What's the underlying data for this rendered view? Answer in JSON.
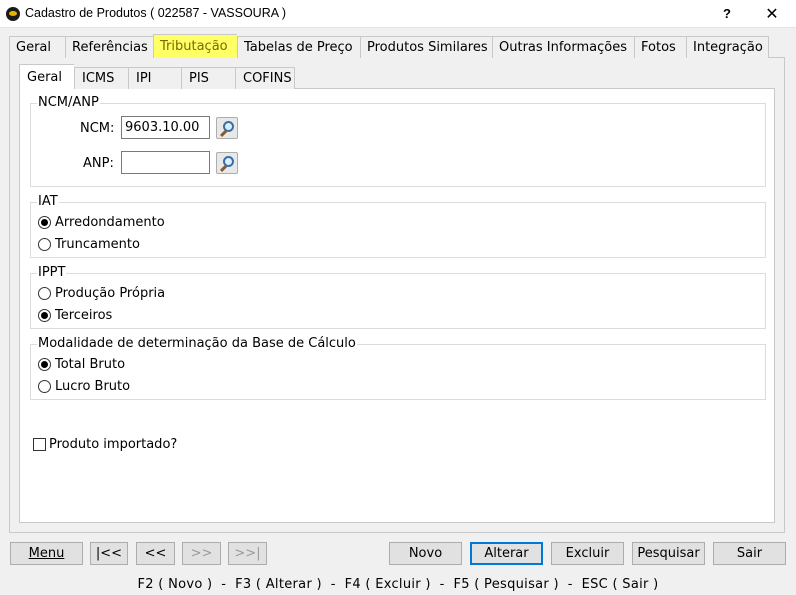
{
  "window": {
    "title": "Cadastro de Produtos ( 022587 - VASSOURA )",
    "help_label": "?",
    "close_label": "✕"
  },
  "outer_tabs": [
    {
      "label": "Geral"
    },
    {
      "label": "Referências"
    },
    {
      "label": "Tributação",
      "active": true
    },
    {
      "label": "Tabelas de Preço"
    },
    {
      "label": "Produtos Similares"
    },
    {
      "label": "Outras Informações"
    },
    {
      "label": "Fotos"
    },
    {
      "label": "Integração"
    }
  ],
  "inner_tabs": [
    {
      "label": "Geral",
      "active": true
    },
    {
      "label": "ICMS"
    },
    {
      "label": "IPI"
    },
    {
      "label": "PIS"
    },
    {
      "label": "COFINS"
    }
  ],
  "ncm_anp": {
    "legend": "NCM/ANP",
    "ncm_label": "NCM:",
    "ncm_value": "9603.10.00",
    "anp_label": "ANP:",
    "anp_value": ""
  },
  "iat": {
    "legend": "IAT",
    "options": [
      {
        "label": "Arredondamento",
        "checked": true
      },
      {
        "label": "Truncamento",
        "checked": false
      }
    ]
  },
  "ippt": {
    "legend": "IPPT",
    "options": [
      {
        "label": "Produção Própria",
        "checked": false
      },
      {
        "label": "Terceiros",
        "checked": true
      }
    ]
  },
  "modalidade": {
    "legend": "Modalidade de determinação da Base de Cálculo",
    "options": [
      {
        "label": "Total Bruto",
        "checked": true
      },
      {
        "label": "Lucro Bruto",
        "checked": false
      }
    ]
  },
  "produto_importado": {
    "label": "Produto importado?",
    "checked": false
  },
  "buttons": {
    "menu": "Menu",
    "first": "|<<",
    "prev": "<<",
    "next": ">>",
    "last": ">>|",
    "novo": "Novo",
    "alterar": "Alterar",
    "excluir": "Excluir",
    "pesquisar": "Pesquisar",
    "sair": "Sair"
  },
  "status_bar": "F2 ( Novo )  -  F3 ( Alterar )  -  F4 ( Excluir )  -  F5 ( Pesquisar )  -  ESC ( Sair )",
  "colors": {
    "active_tab_highlight": "#ffff66",
    "default_button_border": "#0078d7",
    "window_background": "#f0f0f0"
  }
}
